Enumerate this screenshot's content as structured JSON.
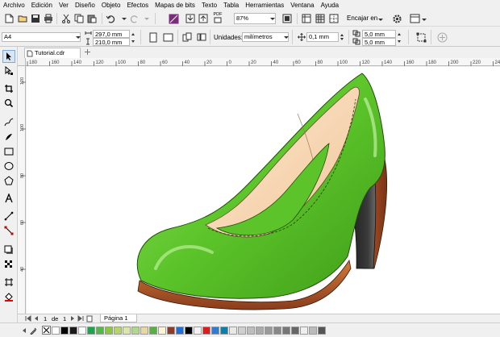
{
  "menu": [
    "Archivo",
    "Edición",
    "Ver",
    "Diseño",
    "Objeto",
    "Efectos",
    "Mapas de bits",
    "Texto",
    "Tabla",
    "Herramientas",
    "Ventana",
    "Ayuda"
  ],
  "toolbar": {
    "zoom": "87%",
    "snap_label": "Encajar en",
    "pdf_label": "PDF"
  },
  "property_bar": {
    "page_size": "A4",
    "width": "297,0 mm",
    "height": "210,0 mm",
    "units_label": "Unidades:",
    "units_value": "milímetros",
    "nudge": "0,1 mm",
    "dup_x": "5,0 mm",
    "dup_y": "5,0 mm"
  },
  "document_tab": "Tutorial.cdr",
  "ruler": {
    "h_ticks": [
      "180",
      "160",
      "140",
      "120",
      "100",
      "80",
      "60",
      "40",
      "20",
      "0",
      "20",
      "40",
      "60",
      "80",
      "100",
      "120",
      "140",
      "160",
      "180",
      "200",
      "220",
      "240"
    ],
    "v_ticks": [
      "120",
      "100",
      "80",
      "60",
      "40"
    ]
  },
  "page_nav": {
    "current": "1",
    "of_label": "de",
    "total": "1",
    "page_tab": "Página 1"
  },
  "palette_colors": [
    "#ffffff",
    "#000000",
    "#1a1a1a",
    "#ffffff",
    "#1aa54b",
    "#52b848",
    "#8cc63f",
    "#b5d56a",
    "#d9e8a6",
    "#b0d88c",
    "#e7d8a2",
    "#58b044",
    "#fff4d6",
    "#8b3b2a",
    "#1f6fd6",
    "#000000",
    "#f2f2f2",
    "#d91e1e",
    "#2a7fd4",
    "#0d7fa8",
    "#e8e8e8",
    "#cfcfcf",
    "#bdbdbd",
    "#ababab",
    "#9a9a9a",
    "#888888",
    "#777777",
    "#666666",
    "#eeeeee",
    "#bbbbbb",
    "#555555"
  ],
  "colors": {
    "shoe_green": "#5cc42a",
    "shoe_lining": "#f8d7b0",
    "heel_brown": "#a8502a",
    "heel_dark": "#2a2a2a"
  }
}
